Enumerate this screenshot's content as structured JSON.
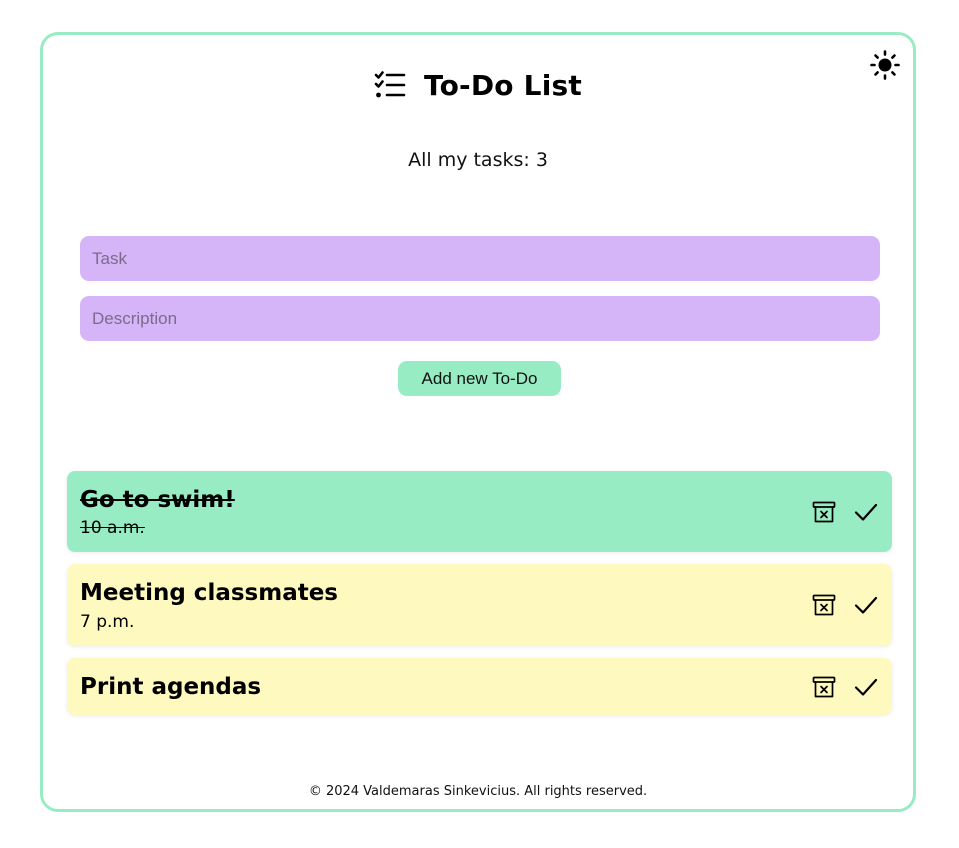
{
  "header": {
    "title": "To-Do List",
    "icon": "checklist-icon"
  },
  "theme_toggle": {
    "icon": "sun-icon"
  },
  "summary": {
    "text": "All my tasks: 3"
  },
  "form": {
    "task_placeholder": "Task",
    "task_value": "",
    "description_placeholder": "Description",
    "description_value": "",
    "add_label": "Add new To-Do"
  },
  "todos": [
    {
      "title": "Go to swim!",
      "description": "10 a.m.",
      "completed": true
    },
    {
      "title": "Meeting classmates",
      "description": "7 p.m.",
      "completed": false
    },
    {
      "title": "Print agendas",
      "description": "",
      "completed": false
    }
  ],
  "colors": {
    "accent_green": "#98ecc4",
    "input_purple": "#d5b4f8",
    "pending_yellow": "#fef9be"
  },
  "footer": {
    "text": "© 2024 Valdemaras Sinkevicius. All rights reserved."
  }
}
